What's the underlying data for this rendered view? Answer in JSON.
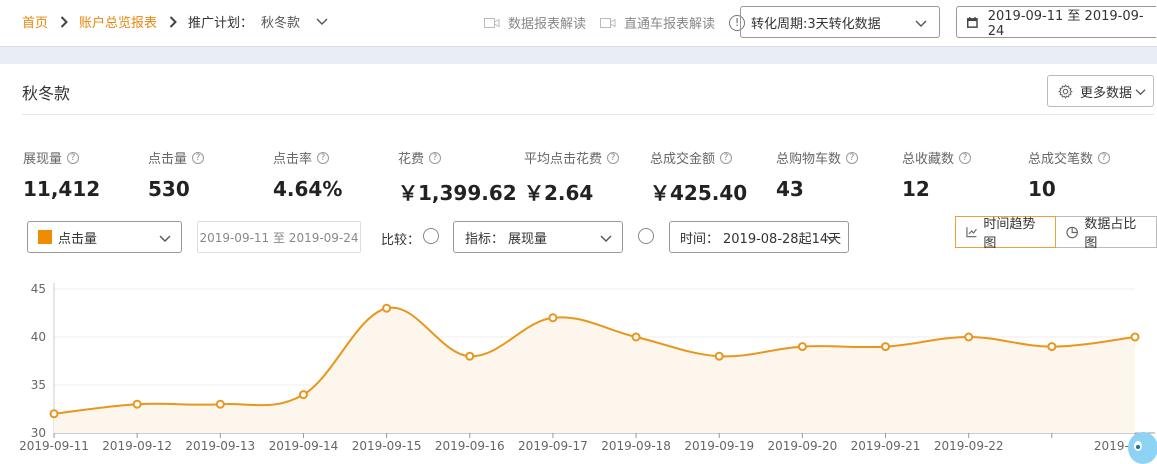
{
  "breadcrumb": {
    "home": "首页",
    "overview": "账户总览报表"
  },
  "plan": {
    "label": "推广计划：",
    "value": "秋冬款"
  },
  "help_links": {
    "data_report": "数据报表解读",
    "ztc_report": "直通车报表解读",
    "info_icon": "!"
  },
  "period_select": {
    "value": "转化周期:3天转化数据"
  },
  "date_range": {
    "value": "2019-09-11 至 2019-09-24"
  },
  "section": {
    "title": "秋冬款",
    "more_data": "更多数据"
  },
  "metrics": [
    {
      "label": "展现量",
      "value": "11,412"
    },
    {
      "label": "点击量",
      "value": "530"
    },
    {
      "label": "点击率",
      "value": "4.64%"
    },
    {
      "label": "花费",
      "value": "￥1,399.62"
    },
    {
      "label": "平均点击花费",
      "value": "￥2.64"
    },
    {
      "label": "总成交金额",
      "value": "￥425.40"
    },
    {
      "label": "总购物车数",
      "value": "43"
    },
    {
      "label": "总收藏数",
      "value": "12"
    },
    {
      "label": "总成交笔数",
      "value": "10"
    }
  ],
  "controls": {
    "metric_select": "点击量",
    "date_input_placeholder": "2019-09-11 至 2019-09-24",
    "compare_label": "比较：",
    "indicator_label": "指标：",
    "indicator_value": "展现量",
    "time_label": "时间：",
    "time_value": "2019-08-28起14天",
    "trend_view": "时间趋势图",
    "share_view": "数据占比图",
    "swatch_color": "#f08c00"
  },
  "chart_data": {
    "type": "area",
    "x": [
      "2019-09-11",
      "2019-09-12",
      "2019-09-13",
      "2019-09-14",
      "2019-09-15",
      "2019-09-16",
      "2019-09-17",
      "2019-09-18",
      "2019-09-19",
      "2019-09-20",
      "2019-09-21",
      "2019-09-22",
      "2019-09-23",
      "2019-09-24"
    ],
    "x_tick_labels": [
      "2019-09-11",
      "2019-09-12",
      "2019-09-13",
      "2019-09-14",
      "2019-09-15",
      "2019-09-16",
      "2019-09-17",
      "2019-09-18",
      "2019-09-19",
      "2019-09-20",
      "2019-09-21",
      "2019-09-22",
      "",
      "2019-09"
    ],
    "series": [
      {
        "values": [
          32,
          33,
          33,
          34,
          43,
          38,
          42,
          40,
          38,
          39,
          39,
          40,
          39,
          40
        ]
      }
    ],
    "y_ticks": [
      30,
      35,
      40,
      45
    ],
    "ylim": [
      30,
      45
    ],
    "grid": true,
    "line_color": "#e8961e",
    "fill_color": "#fdf6ec"
  }
}
